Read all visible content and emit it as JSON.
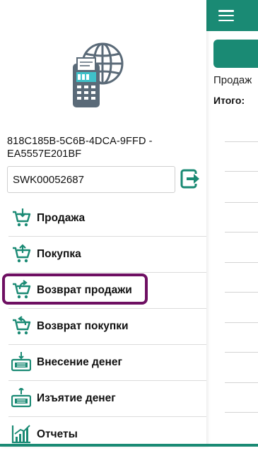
{
  "device_id": "818C185B-5C6B-4DCA-9FFD -EA5557E201BF",
  "shop_code": "SWK00052687",
  "menu": {
    "items": [
      {
        "label": "Продажа",
        "icon": "cart-in-icon"
      },
      {
        "label": "Покупка",
        "icon": "cart-out-icon"
      },
      {
        "label": "Возврат продажи",
        "icon": "cart-return-icon",
        "selected": true
      },
      {
        "label": "Возврат покупки",
        "icon": "cart-return-purchase-icon"
      },
      {
        "label": "Внесение денег",
        "icon": "cash-in-icon"
      },
      {
        "label": "Изъятие денег",
        "icon": "cash-out-icon"
      },
      {
        "label": "Отчеты",
        "icon": "report-chart-icon"
      }
    ]
  },
  "background": {
    "sales_label": "Продаж",
    "total_label": "Итого:"
  },
  "colors": {
    "accent": "#1a8a74",
    "selection": "#6e0f62",
    "logo": "#5a6a78"
  }
}
